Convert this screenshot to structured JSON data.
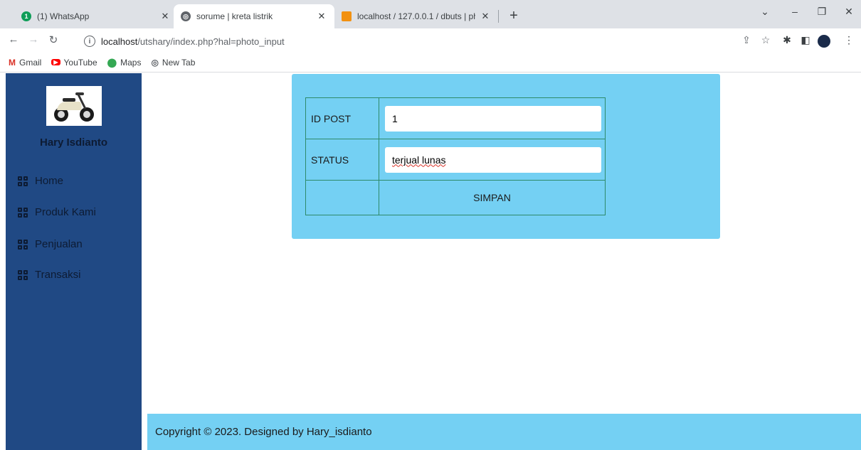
{
  "browser": {
    "tabs": [
      {
        "title": "(1) WhatsApp",
        "favicon": "whatsapp-icon",
        "badge": "1"
      },
      {
        "title": "sorume | kreta listrik",
        "favicon": "globe-icon",
        "active": true
      },
      {
        "title": "localhost / 127.0.0.1 / dbuts | php",
        "favicon": "phpmyadmin-icon"
      }
    ],
    "url_host": "localhost",
    "url_path": "/utshary/index.php?hal=photo_input",
    "bookmarks": [
      "Gmail",
      "YouTube",
      "Maps",
      "New Tab"
    ]
  },
  "sidebar": {
    "username": "Hary Isdianto",
    "items": [
      "Home",
      "Produk Kami",
      "Penjualan",
      "Transaksi"
    ]
  },
  "form": {
    "id_label": "ID POST",
    "id_value": "1",
    "status_label": "STATUS",
    "status_value": "terjual lunas",
    "submit_label": "SIMPAN"
  },
  "footer": {
    "text": "Copyright © 2023. Designed by Hary_isdianto"
  },
  "colors": {
    "sidebar": "#204984",
    "accent": "#74d0f3"
  }
}
